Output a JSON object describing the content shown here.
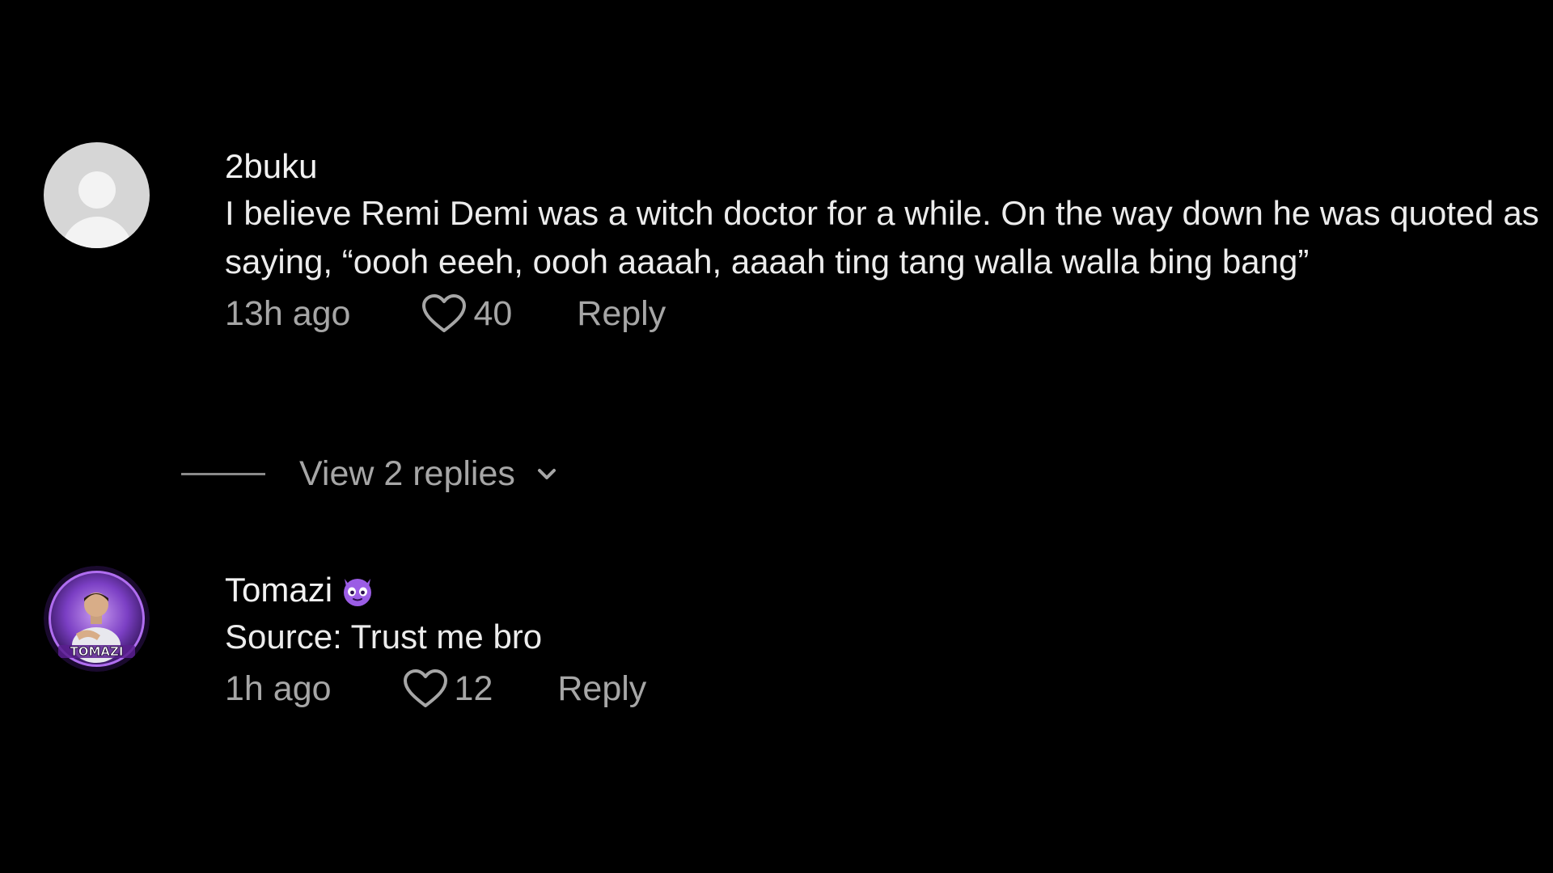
{
  "colors": {
    "background": "#000000",
    "text_primary": "#ececec",
    "text_secondary": "#a6a6a6",
    "accent_purple": "#7b3fc4"
  },
  "comments": [
    {
      "username": "2buku",
      "avatar": "default-avatar-icon",
      "text": "I believe Remi Demi was a witch doctor for a while. On the way down he was quoted as saying, “oooh eeeh, oooh aaaah, aaaah ting tang walla walla bing bang”",
      "timestamp": "13h ago",
      "likes": "40",
      "reply_label": "Reply"
    },
    {
      "username": "Tomazi",
      "username_emoji": "smiling-devil-emoji",
      "avatar": "tomazi-avatar",
      "avatar_text": "TOMAZI",
      "text": "Source: Trust me bro",
      "timestamp": "1h ago",
      "likes": "12",
      "reply_label": "Reply"
    }
  ],
  "view_replies": {
    "label": "View 2 replies",
    "icon": "chevron-down-icon"
  },
  "icons": {
    "like": "heart-outline-icon"
  }
}
